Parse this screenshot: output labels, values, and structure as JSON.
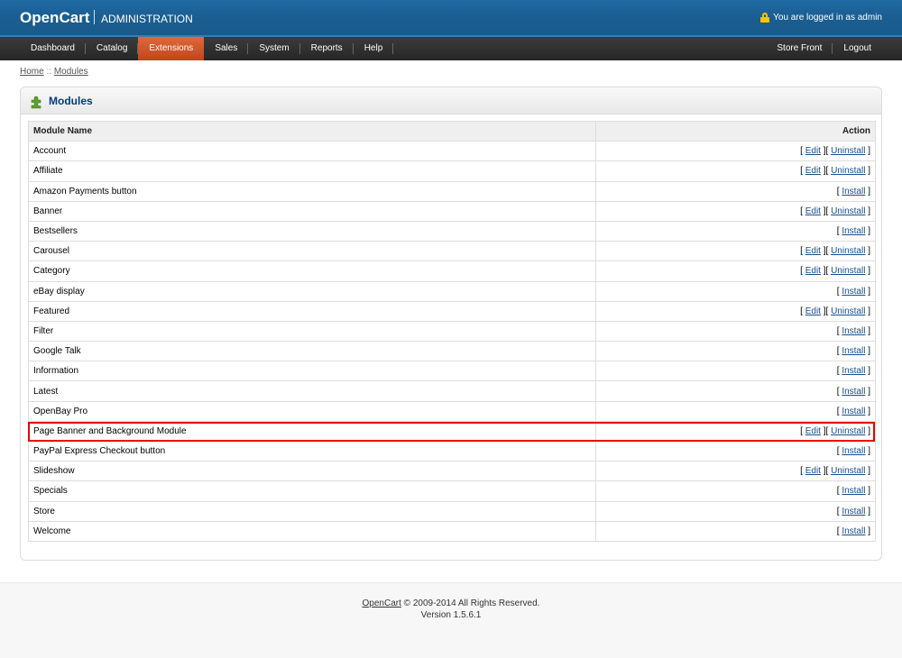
{
  "header": {
    "brand": "OpenCart",
    "subtitle": "ADMINISTRATION",
    "logged_in": "You are logged in as admin"
  },
  "menu": {
    "left": [
      "Dashboard",
      "Catalog",
      "Extensions",
      "Sales",
      "System",
      "Reports",
      "Help"
    ],
    "active": "Extensions",
    "right": [
      "Store Front",
      "Logout"
    ]
  },
  "breadcrumb": {
    "home": "Home",
    "separator": "::",
    "current": "Modules"
  },
  "page": {
    "title": "Modules"
  },
  "table": {
    "headers": [
      "Module Name",
      "Action"
    ],
    "rows": [
      {
        "name": "Account",
        "actions": [
          "Edit",
          "Uninstall"
        ]
      },
      {
        "name": "Affiliate",
        "actions": [
          "Edit",
          "Uninstall"
        ]
      },
      {
        "name": "Amazon Payments button",
        "actions": [
          "Install"
        ]
      },
      {
        "name": "Banner",
        "actions": [
          "Edit",
          "Uninstall"
        ]
      },
      {
        "name": "Bestsellers",
        "actions": [
          "Install"
        ]
      },
      {
        "name": "Carousel",
        "actions": [
          "Edit",
          "Uninstall"
        ]
      },
      {
        "name": "Category",
        "actions": [
          "Edit",
          "Uninstall"
        ]
      },
      {
        "name": "eBay display",
        "actions": [
          "Install"
        ]
      },
      {
        "name": "Featured",
        "actions": [
          "Edit",
          "Uninstall"
        ]
      },
      {
        "name": "Filter",
        "actions": [
          "Install"
        ]
      },
      {
        "name": "Google Talk",
        "actions": [
          "Install"
        ]
      },
      {
        "name": "Information",
        "actions": [
          "Install"
        ]
      },
      {
        "name": "Latest",
        "actions": [
          "Install"
        ]
      },
      {
        "name": "OpenBay Pro",
        "actions": [
          "Install"
        ]
      },
      {
        "name": "Page Banner and Background Module",
        "actions": [
          "Edit",
          "Uninstall"
        ]
      },
      {
        "name": "PayPal Express Checkout button",
        "actions": [
          "Install"
        ]
      },
      {
        "name": "Slideshow",
        "actions": [
          "Edit",
          "Uninstall"
        ]
      },
      {
        "name": "Specials",
        "actions": [
          "Install"
        ]
      },
      {
        "name": "Store",
        "actions": [
          "Install"
        ]
      },
      {
        "name": "Welcome",
        "actions": [
          "Install"
        ]
      }
    ]
  },
  "footer": {
    "link": "OpenCart",
    "copyright": "© 2009-2014 All Rights Reserved.",
    "version": "Version 1.5.6.1"
  },
  "colors": {
    "header_blue": "#1b5e91",
    "menu_dark": "#2e2e2e",
    "menu_active": "#d0552a",
    "title_blue": "#003a88",
    "highlight_red": "#ee0000"
  }
}
